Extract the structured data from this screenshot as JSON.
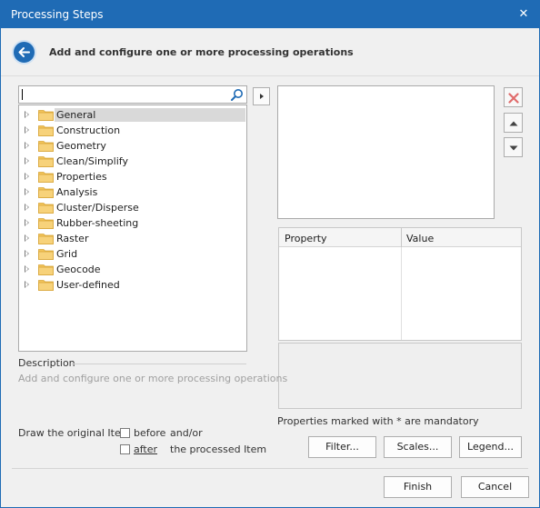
{
  "window": {
    "title": "Processing Steps",
    "close_glyph": "✕"
  },
  "header": {
    "heading": "Add and configure one or more processing operations",
    "back_icon": "back-arrow-icon"
  },
  "search": {
    "value": ""
  },
  "tree": {
    "items": [
      {
        "label": "General",
        "selected": true
      },
      {
        "label": "Construction"
      },
      {
        "label": "Geometry"
      },
      {
        "label": "Clean/Simplify"
      },
      {
        "label": "Properties"
      },
      {
        "label": "Analysis"
      },
      {
        "label": "Cluster/Disperse"
      },
      {
        "label": "Rubber-sheeting"
      },
      {
        "label": "Raster"
      },
      {
        "label": "Grid"
      },
      {
        "label": "Geocode"
      },
      {
        "label": "User-defined"
      }
    ]
  },
  "description": {
    "label": "Description",
    "text": "Add and configure one or more processing operations"
  },
  "properties": {
    "col_property": "Property",
    "col_value": "Value",
    "mandatory_note": "Properties marked with * are mandatory"
  },
  "draw": {
    "label": "Draw the original Item",
    "before": "before",
    "after": "after",
    "andor": "and/or",
    "processed": "the processed Item"
  },
  "buttons": {
    "filter": "Filter...",
    "scales": "Scales...",
    "legend": "Legend...",
    "finish": "Finish",
    "cancel": "Cancel"
  },
  "colors": {
    "accent": "#1f6bb5",
    "folder": "#f2c45a",
    "delete": "#e06c6c"
  }
}
